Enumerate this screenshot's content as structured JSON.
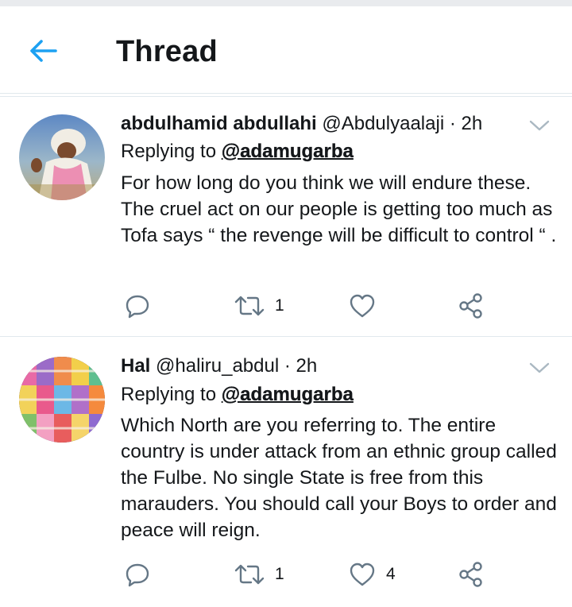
{
  "header": {
    "title": "Thread",
    "back_icon": "arrow-left-icon",
    "accent": "#1da1f2"
  },
  "tweets": [
    {
      "name": "abdulhamid abdullahi",
      "handle": "@Abdulyaalaji",
      "dot": "·",
      "time": "2h",
      "replying_prefix": "Replying to",
      "replying_to": "@adamugarba",
      "text": "For how long do you think we will endure these. The cruel act on our people is getting too much as Tofa says “ the revenge will be difficult to control “ .",
      "retweets": "1",
      "likes": ""
    },
    {
      "name": "Hal",
      "handle": "@haliru_abdul",
      "dot": "·",
      "time": "2h",
      "replying_prefix": "Replying to",
      "replying_to": "@adamugarba",
      "text": "Which North are you referring to. The entire country is under attack from an ethnic group called the Fulbe. No single State is free from this marauders. You should call your Boys to order and peace will reign.",
      "retweets": "1",
      "likes": "4"
    }
  ]
}
